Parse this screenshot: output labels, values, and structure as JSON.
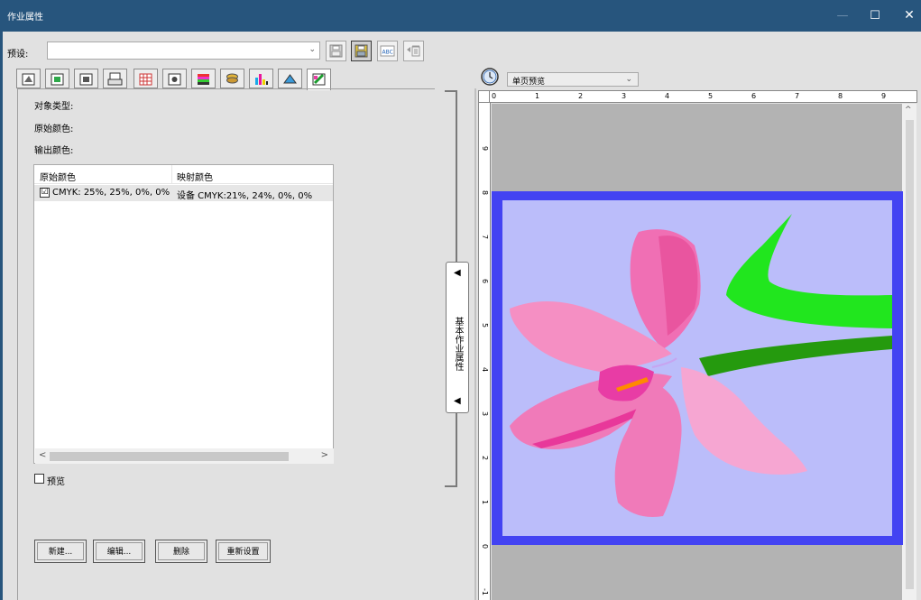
{
  "window": {
    "title": "作业属性",
    "minimize": "—",
    "maximize": "☐",
    "close": "✕"
  },
  "preset": {
    "label": "预设:",
    "value": ""
  },
  "toolbar": {
    "buttons": [
      "save-icon",
      "save-as-icon",
      "spellcheck-icon",
      "delete-icon"
    ],
    "abc_text": "ABC"
  },
  "tabs": [
    "page-layout-icon",
    "media-icon",
    "image-icon",
    "printer-icon",
    "grid-icon",
    "color-settings-icon",
    "color-bars-icon",
    "stack-icon",
    "cmyk-bars-icon",
    "spot-icon",
    "color-replace-icon"
  ],
  "fields": {
    "object_type": "对象类型:",
    "original_color": "原始颜色:",
    "output_color": "输出颜色:"
  },
  "table": {
    "columns": [
      "原始颜色",
      "映射颜色"
    ],
    "rows": [
      {
        "checked": true,
        "check_mark": "☑",
        "original": "CMYK: 25%, 25%, 0%, 0%",
        "mapped": "设备 CMYK:21%, 24%, 0%, 0%"
      }
    ],
    "scroll_left": "<",
    "scroll_right": ">"
  },
  "preview_checkbox": {
    "label": "预览",
    "checked": false
  },
  "buttons": {
    "new": "新建...",
    "edit": "编辑...",
    "delete": "删除",
    "reset": "重新设置"
  },
  "side_tab": {
    "label": "基本作业属性",
    "arrow_top": "◀",
    "arrow_bottom": "◀"
  },
  "preview": {
    "mode": "单页预览",
    "dropdown_arrow": "⌄",
    "ruler_h": [
      "0",
      "1",
      "2",
      "3",
      "4",
      "5",
      "6",
      "7",
      "8",
      "9"
    ],
    "ruler_v": [
      "9",
      "8",
      "7",
      "6",
      "5",
      "4",
      "3",
      "2",
      "1",
      "0",
      "-1"
    ],
    "scroll_up": "^"
  },
  "colors": {
    "title_bar": "#27557d",
    "page_border": "#4343f2",
    "page_bg": "#bbbdfa",
    "flower_pink": "#f06fb4",
    "leaf_green": "#21e61e",
    "stem_green": "#259a0e"
  }
}
